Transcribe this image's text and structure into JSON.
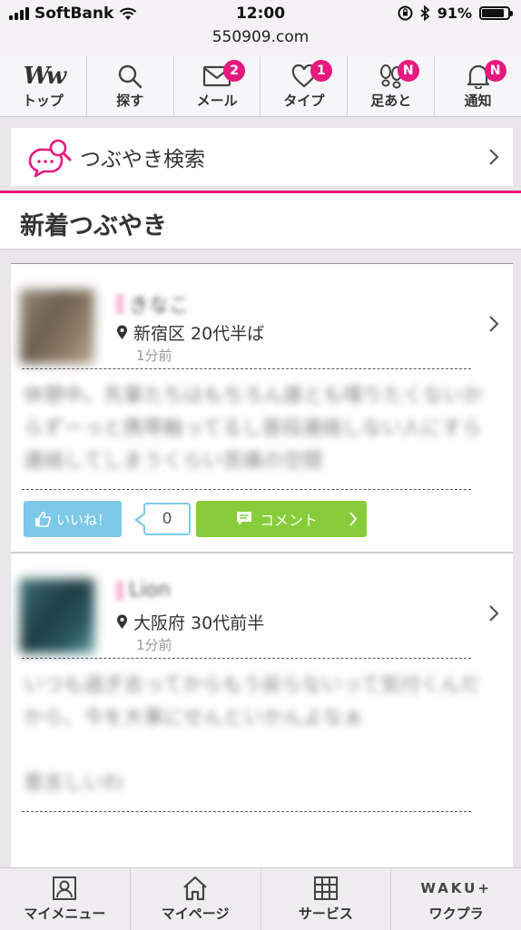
{
  "status_bar": {
    "carrier": "SoftBank",
    "time": "12:00",
    "battery": "91%",
    "battery_level": 0.91,
    "url": "550909.com"
  },
  "top_nav": {
    "items": [
      {
        "label": "トップ",
        "icon": "ww-logo-icon"
      },
      {
        "label": "探す",
        "icon": "search-icon"
      },
      {
        "label": "メール",
        "icon": "mail-icon",
        "badge": "2"
      },
      {
        "label": "タイプ",
        "icon": "heart-icon",
        "badge": "1"
      },
      {
        "label": "足あと",
        "icon": "footprints-icon",
        "badge": "N"
      },
      {
        "label": "通知",
        "icon": "bell-icon",
        "badge": "N"
      }
    ]
  },
  "search_row": {
    "label": "つぶやき検索"
  },
  "section": {
    "title": "新着つぶやき"
  },
  "posts": [
    {
      "name": "きなこ",
      "area": "新宿区",
      "age": "20代半ば",
      "time_ago": "1分前",
      "text": "休憩中。先輩たちはもちろん誰とも喋りたくないからずーっと携帯触ってるし普段連絡しない人にすら連絡してしまうくらい苦痛の空間",
      "like_label": "いいね！",
      "like_count": "0",
      "comment_label": "コメント"
    },
    {
      "name": "Lion",
      "area": "大阪府",
      "age": "30代前半",
      "time_ago": "1分前",
      "text": "いつも過ぎ去ってからもう戻らないって気付くんだから、今を大事にせんといかんよなぁ\n\n意言しいわ"
    }
  ],
  "bottom_nav": {
    "items": [
      {
        "label": "マイメニュー",
        "icon": "profile-icon"
      },
      {
        "label": "マイページ",
        "icon": "home-icon"
      },
      {
        "label": "サービス",
        "icon": "grid-icon"
      },
      {
        "label": "ワクプラ",
        "logo": "WAKU+"
      }
    ]
  },
  "colors": {
    "accent": "#e6197f",
    "like": "#7ec8e8",
    "comment": "#87cc3a"
  }
}
